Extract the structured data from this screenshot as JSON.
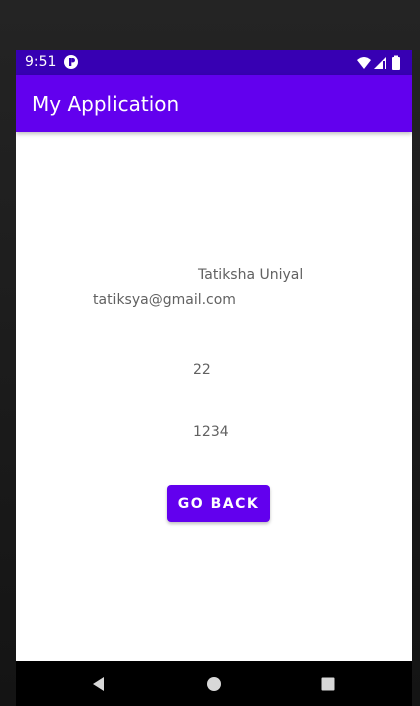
{
  "status_bar": {
    "time": "9:51"
  },
  "app_bar": {
    "title": "My Application"
  },
  "content": {
    "name": "Tatiksha Uniyal",
    "email": "tatiksya@gmail.com",
    "age": "22",
    "number": "1234",
    "go_back_label": "GO BACK"
  },
  "colors": {
    "status_bar": "#3700b3",
    "app_bar": "#6200ee",
    "button": "#6200ee",
    "text": "#616161",
    "nav_bar": "#000000"
  },
  "icons": {
    "status": [
      "app-icon",
      "wifi-icon",
      "cellular-icon",
      "battery-icon"
    ],
    "navigation": [
      "back-icon",
      "home-icon",
      "recents-icon"
    ]
  }
}
